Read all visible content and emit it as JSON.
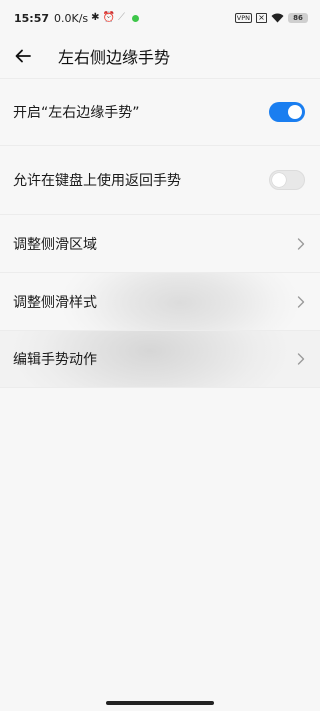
{
  "status_bar": {
    "time": "15:57",
    "speed": "0.0K/s",
    "vpn": "VPN",
    "battery": "86"
  },
  "header": {
    "title": "左右侧边缘手势"
  },
  "settings": {
    "items": [
      {
        "label": "开启“左右边缘手势”",
        "control": "toggle",
        "state": "on"
      },
      {
        "label": "允许在键盘上使用返回手势",
        "control": "toggle",
        "state": "off"
      },
      {
        "label": "调整侧滑区域",
        "control": "chevron"
      },
      {
        "label": "调整侧滑样式",
        "control": "chevron"
      },
      {
        "label": "编辑手势动作",
        "control": "chevron"
      }
    ]
  },
  "colors": {
    "accent": "#1a7ef0",
    "background": "#f7f7f7"
  }
}
